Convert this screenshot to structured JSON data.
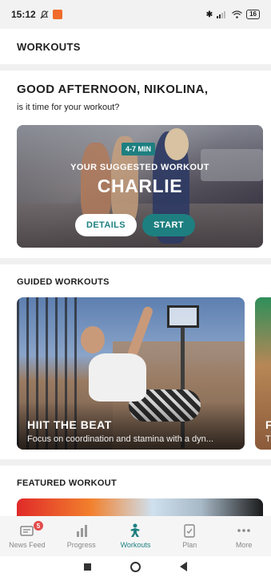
{
  "status_bar": {
    "time": "15:12",
    "battery": "16"
  },
  "header": {
    "title": "WORKOUTS"
  },
  "greeting": {
    "title": "GOOD AFTERNOON, NIKOLINA,",
    "subtitle": "is it time for your workout?"
  },
  "suggested": {
    "duration_badge": "4-7 MIN",
    "label": "YOUR SUGGESTED WORKOUT",
    "name": "CHARLIE",
    "details_button": "DETAILS",
    "start_button": "START"
  },
  "guided": {
    "section_title": "GUIDED WORKOUTS",
    "cards": [
      {
        "title": "HIIT THE BEAT",
        "description": "Focus on coordination and stamina with a dyn..."
      },
      {
        "title": "F",
        "description": "T"
      }
    ]
  },
  "featured": {
    "section_title": "FEATURED WORKOUT"
  },
  "bottom_nav": {
    "items": [
      {
        "label": "News Feed",
        "icon": "news-feed-icon",
        "badge": "5"
      },
      {
        "label": "Progress",
        "icon": "progress-chart-icon"
      },
      {
        "label": "Workouts",
        "icon": "workouts-icon",
        "active": true
      },
      {
        "label": "Plan",
        "icon": "plan-icon"
      },
      {
        "label": "More",
        "icon": "more-dots-icon"
      }
    ]
  },
  "colors": {
    "accent": "#1e7f80",
    "badge": "#e44c4c"
  }
}
